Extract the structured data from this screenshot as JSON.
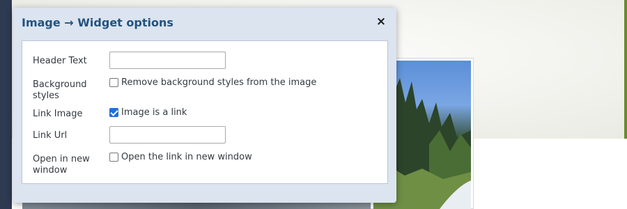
{
  "dialog": {
    "title": "Image → Widget options",
    "close_icon": "×"
  },
  "fields": {
    "header_text": {
      "label": "Header Text",
      "value": ""
    },
    "background_styles": {
      "label": "Background styles",
      "checkbox_label": "Remove background styles from the image",
      "checked": false
    },
    "link_image": {
      "label": "Link Image",
      "checkbox_label": "Image is a link",
      "checked": true
    },
    "link_url": {
      "label": "Link Url",
      "value": ""
    },
    "open_new_window": {
      "label": "Open in new window",
      "checkbox_label": "Open the link in new window",
      "checked": false
    }
  },
  "colors": {
    "title": "#24527f",
    "dialog_bg": "#dbe4ef",
    "checkbox_checked": "#1f6fe0"
  }
}
